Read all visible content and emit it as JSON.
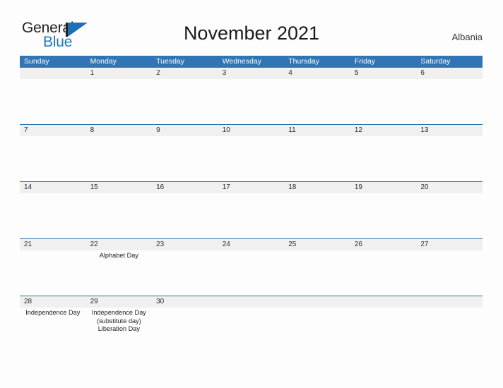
{
  "logo": {
    "text_dark": "General",
    "text_blue": "Blue",
    "flag_icon": "triangle-flag-icon",
    "blue_color": "#1a6fb5"
  },
  "header": {
    "title": "November 2021",
    "country": "Albania"
  },
  "calendar": {
    "header_color": "#3175b5",
    "number_band_color": "#f0f0f0",
    "rule_color": "#2e6da4",
    "day_names": [
      "Sunday",
      "Monday",
      "Tuesday",
      "Wednesday",
      "Thursday",
      "Friday",
      "Saturday"
    ],
    "weeks": [
      {
        "days": [
          {
            "num": "",
            "events": []
          },
          {
            "num": "1",
            "events": []
          },
          {
            "num": "2",
            "events": []
          },
          {
            "num": "3",
            "events": []
          },
          {
            "num": "4",
            "events": []
          },
          {
            "num": "5",
            "events": []
          },
          {
            "num": "6",
            "events": []
          }
        ]
      },
      {
        "days": [
          {
            "num": "7",
            "events": []
          },
          {
            "num": "8",
            "events": []
          },
          {
            "num": "9",
            "events": []
          },
          {
            "num": "10",
            "events": []
          },
          {
            "num": "11",
            "events": []
          },
          {
            "num": "12",
            "events": []
          },
          {
            "num": "13",
            "events": []
          }
        ]
      },
      {
        "days": [
          {
            "num": "14",
            "events": []
          },
          {
            "num": "15",
            "events": []
          },
          {
            "num": "16",
            "events": []
          },
          {
            "num": "17",
            "events": []
          },
          {
            "num": "18",
            "events": []
          },
          {
            "num": "19",
            "events": []
          },
          {
            "num": "20",
            "events": []
          }
        ]
      },
      {
        "days": [
          {
            "num": "21",
            "events": []
          },
          {
            "num": "22",
            "events": [
              "Alphabet Day"
            ]
          },
          {
            "num": "23",
            "events": []
          },
          {
            "num": "24",
            "events": []
          },
          {
            "num": "25",
            "events": []
          },
          {
            "num": "26",
            "events": []
          },
          {
            "num": "27",
            "events": []
          }
        ]
      },
      {
        "days": [
          {
            "num": "28",
            "events": [
              "Independence Day"
            ]
          },
          {
            "num": "29",
            "events": [
              "Independence Day (substitute day)",
              "Liberation Day"
            ]
          },
          {
            "num": "30",
            "events": []
          },
          {
            "num": "",
            "events": []
          },
          {
            "num": "",
            "events": []
          },
          {
            "num": "",
            "events": []
          },
          {
            "num": "",
            "events": []
          }
        ]
      }
    ]
  }
}
